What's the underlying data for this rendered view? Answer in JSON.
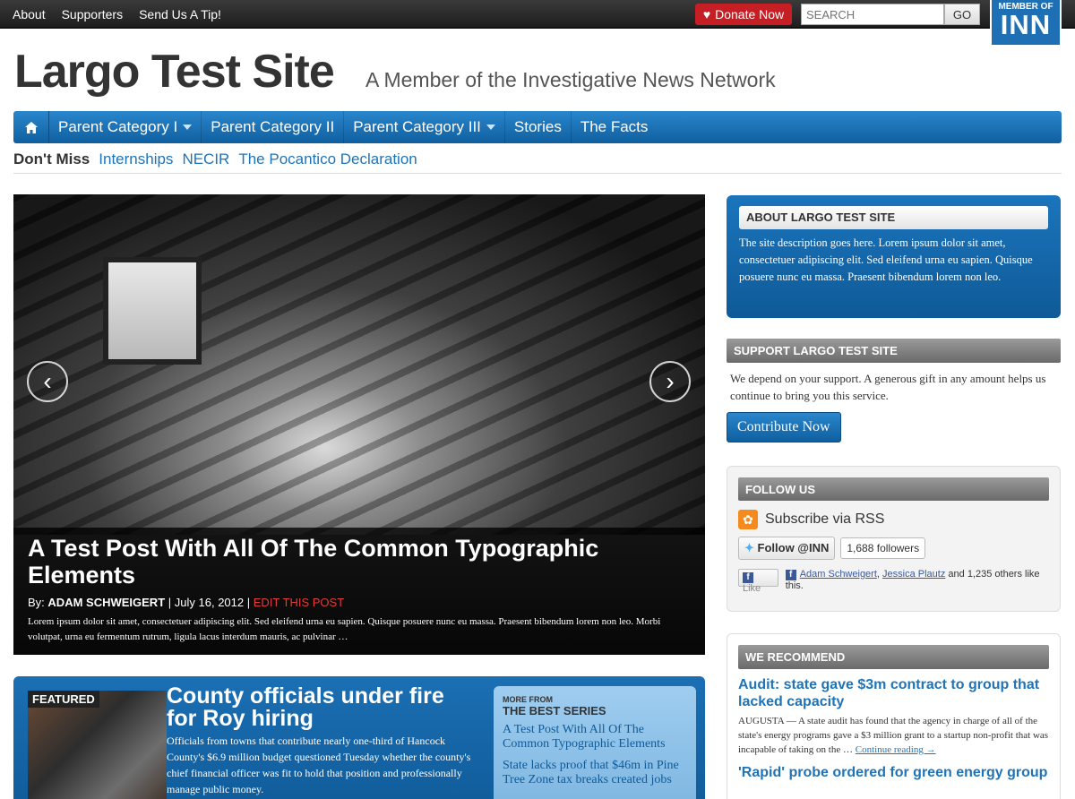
{
  "topbar": {
    "links": [
      "About",
      "Supporters",
      "Send Us A Tip!"
    ],
    "donate_label": "Donate Now",
    "search_placeholder": "SEARCH",
    "go_label": "GO",
    "inn_top": "MEMBER OF",
    "inn_main": "INN"
  },
  "masthead": {
    "title": "Largo Test Site",
    "description": "A Member of the Investigative News Network"
  },
  "nav": {
    "items": [
      {
        "label": "Parent Category I",
        "dropdown": true
      },
      {
        "label": "Parent Category II",
        "dropdown": false
      },
      {
        "label": "Parent Category III",
        "dropdown": true
      },
      {
        "label": "Stories",
        "dropdown": false
      },
      {
        "label": "The Facts",
        "dropdown": false
      }
    ]
  },
  "dont_miss": {
    "label": "Don't Miss",
    "links": [
      "Internships",
      "NECIR",
      "The Pocantico Declaration"
    ]
  },
  "hero": {
    "title": "A Test Post With All Of The Common Typographic Elements",
    "by": "By:",
    "author": "ADAM SCHWEIGERT",
    "date": "July 16, 2012",
    "edit": "EDIT THIS POST",
    "excerpt": "Lorem ipsum dolor sit amet, consectetuer adipiscing elit. Sed eleifend urna eu sapien. Quisque posuere nunc eu massa. Praesent bibendum lorem non leo. Morbi volutpat, urna eu fermentum rutrum, ligula lacus interdum mauris, ac pulvinar …"
  },
  "featured": {
    "tag": "FEATURED",
    "title": "County officials under fire for Roy hiring",
    "text": "Officials from towns that contribute nearly one-third of Hancock County's $6.9 million budget questioned Tuesday whether the county's chief financial officer was fit to hold that position and professionally manage public money.",
    "series_kicker": "MORE FROM",
    "series_title": "THE BEST SERIES",
    "series_links": [
      "A Test Post With All Of The Common Typographic Elements",
      "State lacks proof that $46m in Pine Tree Zone tax breaks created jobs"
    ]
  },
  "sidebar": {
    "about_title": "ABOUT LARGO TEST SITE",
    "about_text": "The site description goes here. Lorem ipsum dolor sit amet, consectetuer adipiscing elit. Sed eleifend urna eu sapien. Quisque posuere nunc eu massa. Praesent bibendum lorem non leo.",
    "support_title": "SUPPORT LARGO TEST SITE",
    "support_text": "We depend on your support. A generous gift in any amount helps us continue to bring you this service.",
    "contribute_label": "Contribute Now",
    "follow_title": "FOLLOW US",
    "rss_label": "Subscribe via RSS",
    "twitter_label": "Follow @INN",
    "twitter_count": "1,688 followers",
    "fb_like": "Like",
    "fb_names_1": "Adam Schweigert",
    "fb_names_2": "Jessica Plautz",
    "fb_rest": "and 1,235 others like this.",
    "rec_title": "WE RECOMMEND",
    "rec_items": [
      {
        "title": "Audit: state gave $3m contract to group that lacked capacity",
        "text": "AUGUSTA — A state audit has found that the agency in charge of all of the state's energy programs gave a $3 million grant to a startup non-profit that was incapable of taking on the …",
        "more": "Continue reading →"
      },
      {
        "title": "'Rapid' probe ordered for green energy group"
      }
    ]
  },
  "colors": {
    "accent": "#1f74b8",
    "donate": "#c51f25",
    "edit": "#e23b3b"
  }
}
